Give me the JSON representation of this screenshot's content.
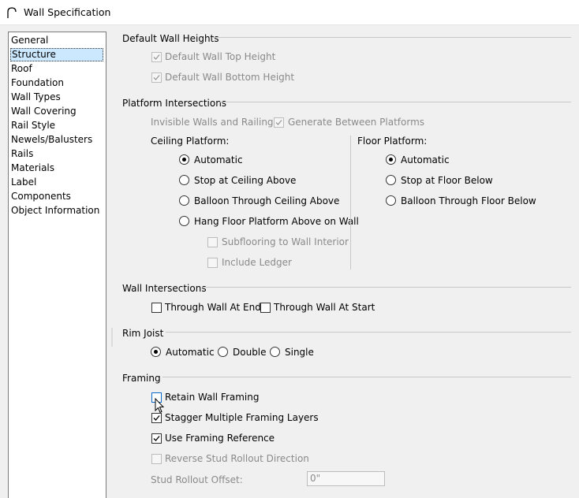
{
  "window": {
    "title": "Wall Specification"
  },
  "sidebar": {
    "items": [
      "General",
      "Structure",
      "Roof",
      "Foundation",
      "Wall Types",
      "Wall Covering",
      "Rail Style",
      "Newels/Balusters",
      "Rails",
      "Materials",
      "Label",
      "Components",
      "Object Information"
    ],
    "selected": "Structure"
  },
  "default_heights": {
    "heading": "Default Wall Heights",
    "top_height": {
      "label": "Default Wall Top Height",
      "checked": true,
      "enabled": false
    },
    "bottom_height": {
      "label": "Default Wall Bottom Height",
      "checked": true,
      "enabled": false
    }
  },
  "platform": {
    "heading": "Platform Intersections",
    "invisible_label": "Invisible Walls and Railings:",
    "generate": {
      "label": "Generate Between Platforms",
      "checked": true,
      "enabled": false
    },
    "ceiling": {
      "heading": "Ceiling Platform:",
      "options": [
        "Automatic",
        "Stop at Ceiling Above",
        "Balloon Through Ceiling Above",
        "Hang Floor Platform Above on Wall"
      ],
      "selected": "Automatic",
      "subflooring": {
        "label": "Subflooring to Wall Interior",
        "checked": false,
        "enabled": false
      },
      "ledger": {
        "label": "Include Ledger",
        "checked": false,
        "enabled": false
      }
    },
    "floor": {
      "heading": "Floor Platform:",
      "options": [
        "Automatic",
        "Stop at Floor Below",
        "Balloon Through Floor Below"
      ],
      "selected": "Automatic"
    }
  },
  "wall_intersections": {
    "heading": "Wall Intersections",
    "end": {
      "label": "Through Wall At End",
      "checked": false
    },
    "start": {
      "label": "Through Wall At Start",
      "checked": false
    }
  },
  "rim_joist": {
    "heading": "Rim Joist",
    "options": [
      "Automatic",
      "Double",
      "Single"
    ],
    "selected": "Automatic"
  },
  "framing": {
    "heading": "Framing",
    "retain": {
      "label": "Retain Wall Framing",
      "checked": false
    },
    "stagger": {
      "label": "Stagger Multiple Framing Layers",
      "checked": true
    },
    "reference": {
      "label": "Use Framing Reference",
      "checked": true
    },
    "reverse": {
      "label": "Reverse Stud Rollout Direction",
      "checked": false,
      "enabled": false
    },
    "offset_label": "Stud Rollout Offset:",
    "offset_value": "0\""
  }
}
